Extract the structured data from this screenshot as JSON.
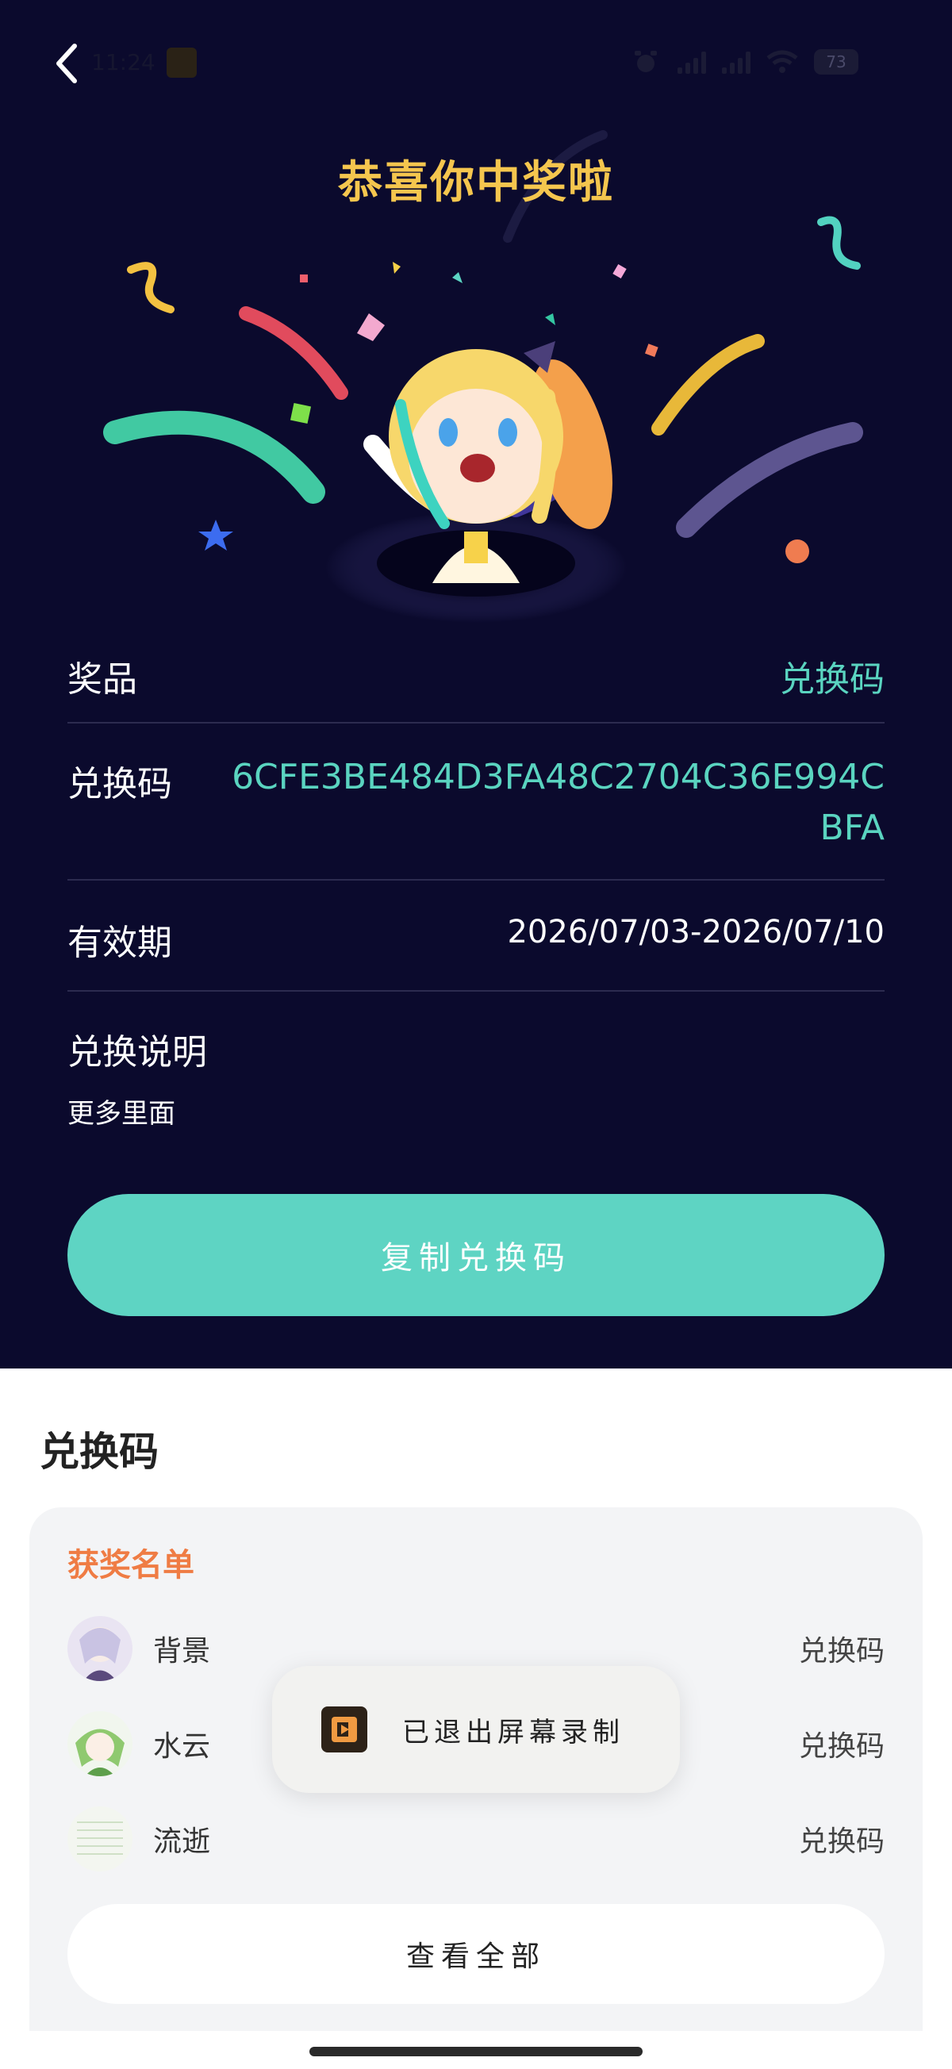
{
  "status_bar": {
    "time": "11:24",
    "battery": "73"
  },
  "header": {
    "title": "恭喜你中奖啦"
  },
  "prize_details": {
    "prize_label": "奖品",
    "prize_value": "兑换码",
    "code_label": "兑换码",
    "code_value": "6CFE3BE484D3FA48C2704C36E994CBFA",
    "validity_label": "有效期",
    "validity_value": "2026/07/03-2026/07/10",
    "instructions_label": "兑换说明",
    "instructions_text": "更多里面"
  },
  "copy_button": {
    "label": "复制兑换码"
  },
  "section": {
    "title": "兑换码"
  },
  "winners": {
    "title": "获奖名单",
    "items": [
      {
        "name": "背景",
        "prize": "兑换码"
      },
      {
        "name": "水云",
        "prize": "兑换码"
      },
      {
        "name": "流逝",
        "prize": "兑换码"
      }
    ],
    "view_all_label": "查看全部"
  },
  "toast": {
    "text": "已退出屏幕录制"
  },
  "colors": {
    "accent_teal": "#5ED4C3",
    "title_gold": "#F5C64E",
    "winners_title": "#EF7C44",
    "background_dark": "#0B0A2D"
  }
}
